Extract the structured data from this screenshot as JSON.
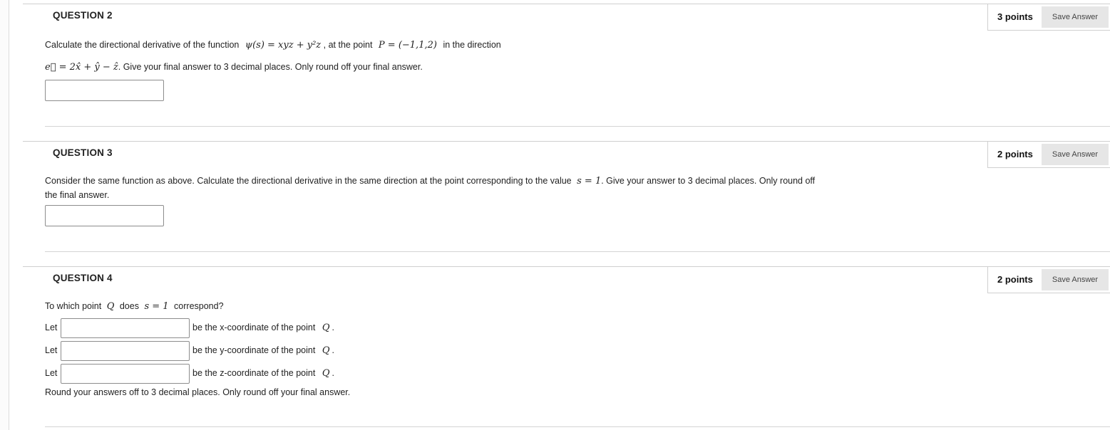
{
  "questions": [
    {
      "title": "QUESTION 2",
      "points": "3 points",
      "save_label": "Save Answer",
      "line1": {
        "pre": "Calculate the directional derivative of the function",
        "func": "ψ(s)  = xyz + y²z",
        "mid": ", at the point",
        "point": "P = (−1,1,2)",
        "post": "in the direction"
      },
      "line2": {
        "vec": "e⃗ = 2x̂ + ŷ − ẑ",
        "post": ". Give your final answer to 3 decimal places. Only round off your final answer."
      },
      "answer_value": ""
    },
    {
      "title": "QUESTION 3",
      "points": "2 points",
      "save_label": "Save Answer",
      "line1": {
        "pre": "Consider the same function as above. Calculate the directional derivative in the same direction at the point corresponding to the value",
        "eq": "s = 1",
        "post": ". Give your answer to 3 decimal places. Only round off"
      },
      "line2": "the final answer.",
      "answer_value": ""
    },
    {
      "title": "QUESTION 4",
      "points": "2 points",
      "save_label": "Save Answer",
      "prompt": {
        "pre": "To which point",
        "q": "Q",
        "mid": "does",
        "eq": "s = 1",
        "post": "correspond?"
      },
      "rows": [
        {
          "let": "Let",
          "value": "",
          "label": "be the x-coordinate of the point",
          "q": "Q",
          "end": "."
        },
        {
          "let": "Let",
          "value": "",
          "label": "be the y-coordinate of the point",
          "q": "Q",
          "end": "."
        },
        {
          "let": "Let",
          "value": "",
          "label": "be the z-coordinate of the point",
          "q": "Q",
          "end": "."
        }
      ],
      "footer": "Round your answers off to 3 decimal places. Only round off your final answer."
    }
  ]
}
